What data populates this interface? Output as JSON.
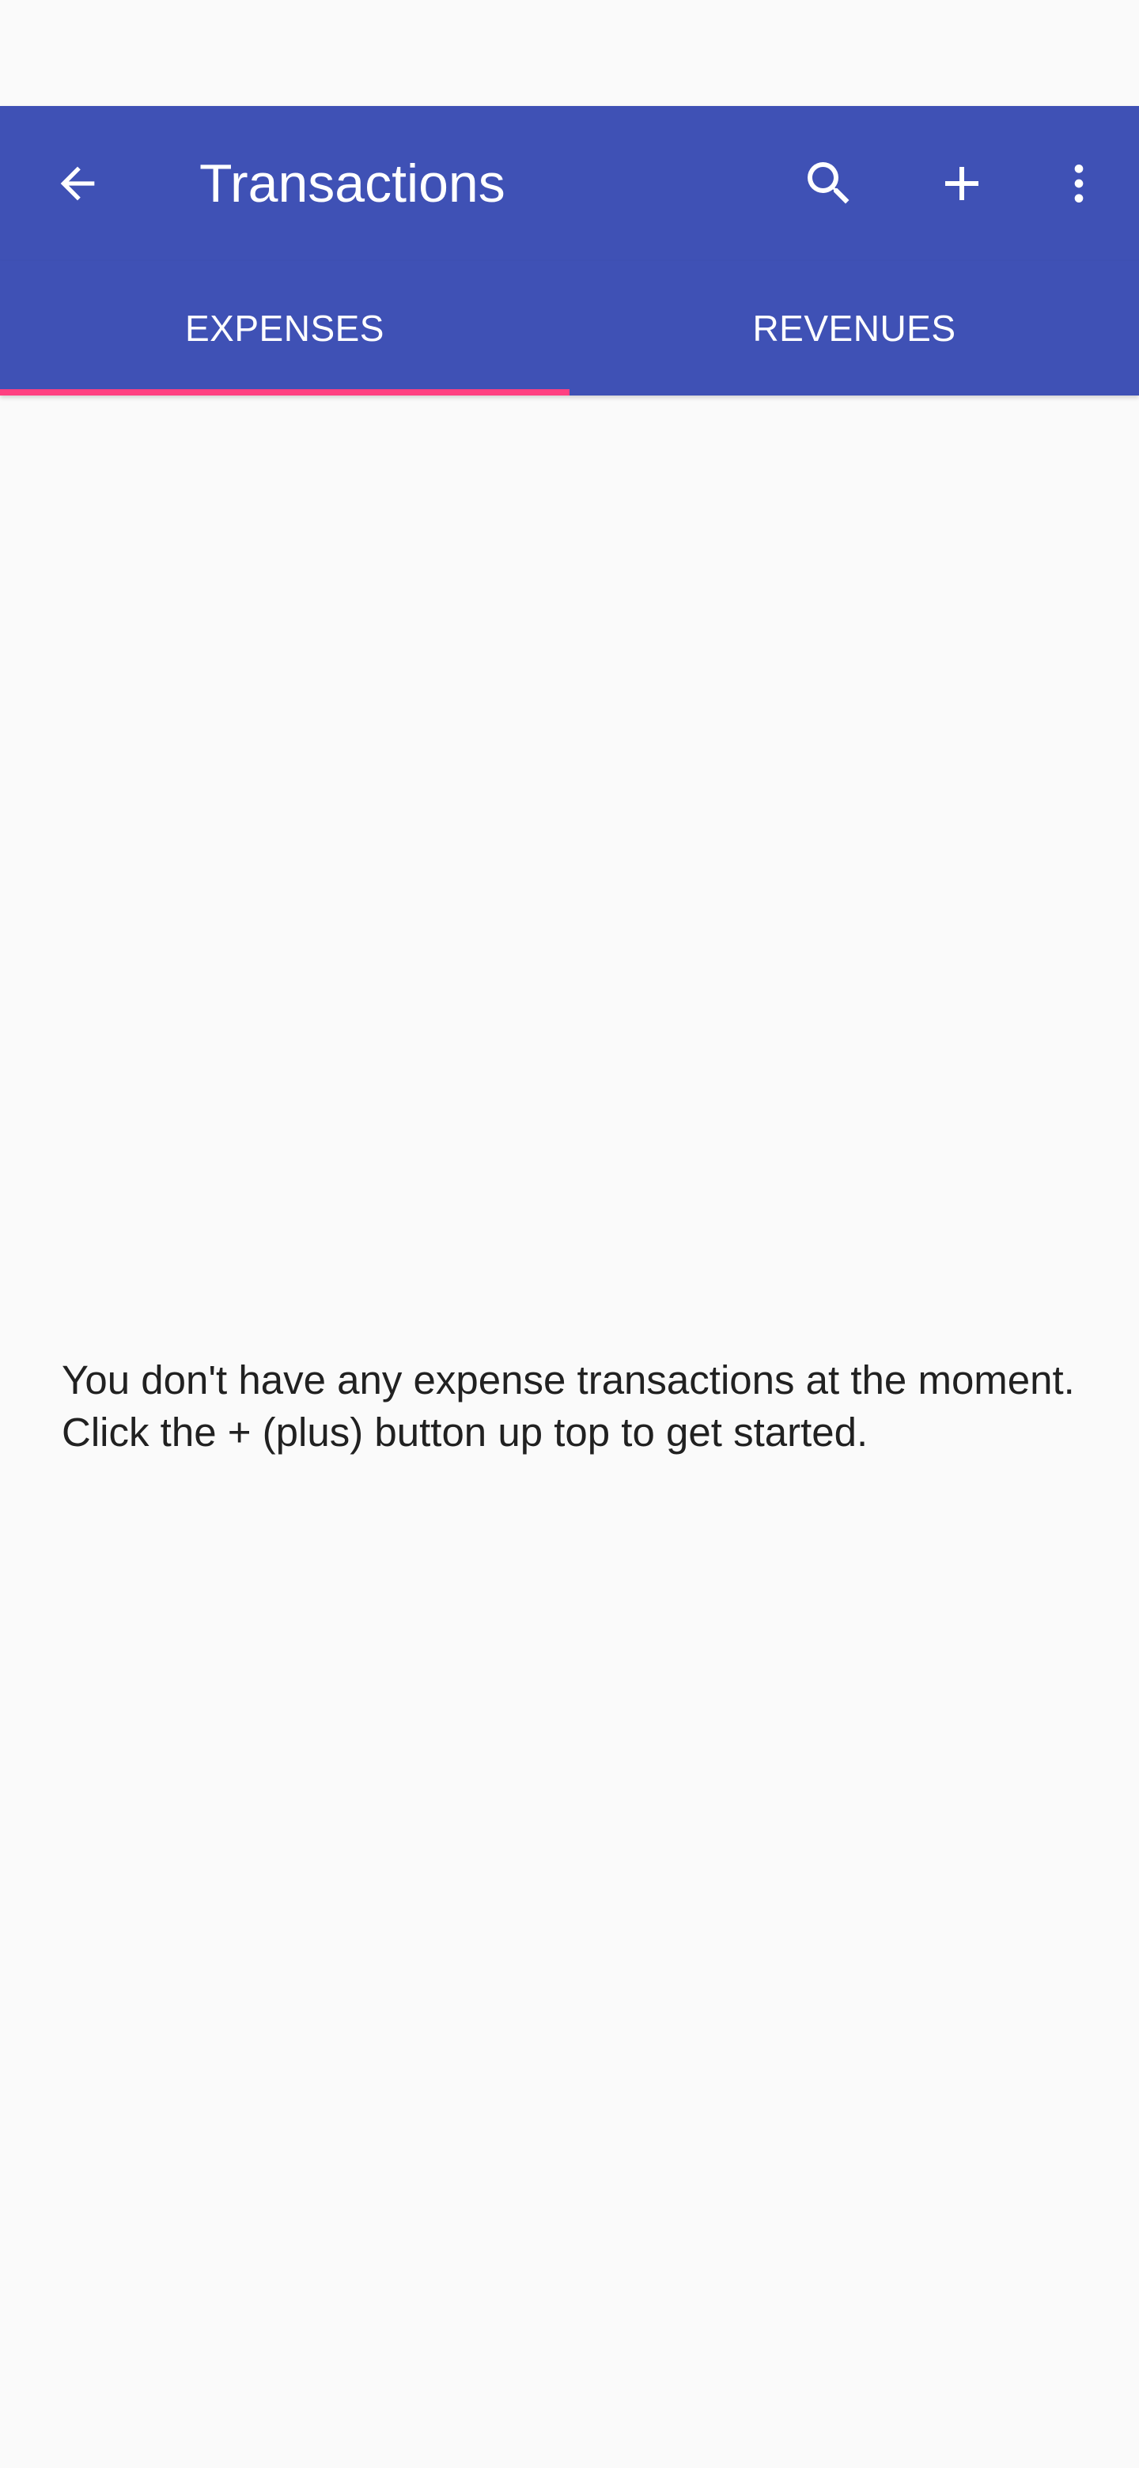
{
  "app_bar": {
    "title": "Transactions",
    "back_icon": "arrow-back-icon",
    "actions": [
      {
        "name": "search",
        "icon": "search-icon"
      },
      {
        "name": "add",
        "icon": "plus-icon"
      },
      {
        "name": "more",
        "icon": "more-vert-icon"
      }
    ]
  },
  "tabs": [
    {
      "label": "EXPENSES",
      "active": true
    },
    {
      "label": "REVENUES",
      "active": false
    }
  ],
  "empty_state": {
    "message": "You don't have any expense transactions at the moment. Click the + (plus) button up top to get started."
  },
  "colors": {
    "primary": "#3f51b5",
    "accent": "#ff4081",
    "background": "#fafafa",
    "text": "#212121"
  }
}
